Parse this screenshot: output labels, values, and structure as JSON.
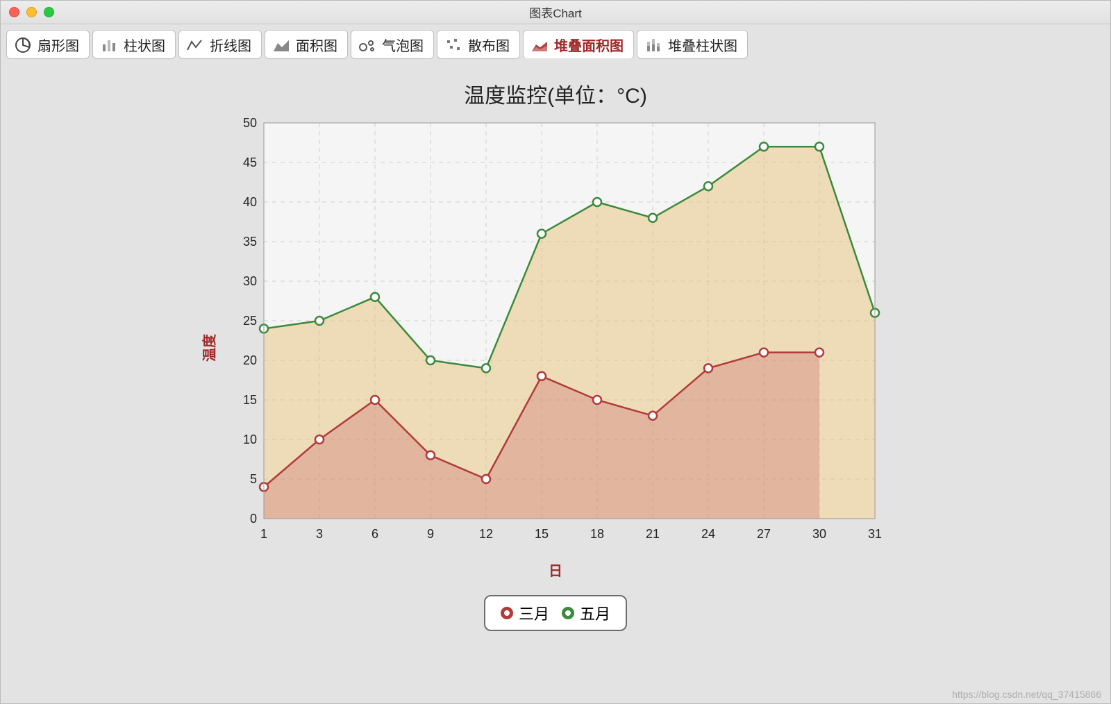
{
  "window": {
    "title": "图表Chart"
  },
  "tabs": [
    {
      "label": "扇形图",
      "icon": "pie-icon"
    },
    {
      "label": "柱状图",
      "icon": "bar-icon"
    },
    {
      "label": "折线图",
      "icon": "line-icon"
    },
    {
      "label": "面积图",
      "icon": "area-icon"
    },
    {
      "label": "气泡图",
      "icon": "bubble-icon"
    },
    {
      "label": "散布图",
      "icon": "scatter-icon"
    },
    {
      "label": "堆叠面积图",
      "icon": "stacked-area-icon"
    },
    {
      "label": "堆叠柱状图",
      "icon": "stacked-bar-icon"
    }
  ],
  "colors": {
    "series1": "#b23a3a",
    "series1_fill": "rgba(200,110,110,0.35)",
    "series2": "#3b8a3b",
    "series2_fill": "rgba(230,190,110,0.45)",
    "accent": "#a02828",
    "grid": "#cfcfcf",
    "plot_bg": "#f5f5f5"
  },
  "legend": [
    {
      "label": "三月",
      "color": "#b23a3a"
    },
    {
      "label": "五月",
      "color": "#3b8a3b"
    }
  ],
  "watermark": "https://blog.csdn.net/qq_37415866",
  "chart_data": {
    "type": "area",
    "stacked": true,
    "title": "温度监控(单位：°C)",
    "xlabel": "日",
    "ylabel": "温度",
    "ylim": [
      0,
      50
    ],
    "yticks": [
      0,
      5,
      10,
      15,
      20,
      25,
      30,
      35,
      40,
      45,
      50
    ],
    "categories": [
      1,
      3,
      6,
      9,
      12,
      15,
      18,
      21,
      24,
      27,
      30,
      31
    ],
    "series": [
      {
        "name": "三月",
        "color": "#b23a3a",
        "values": [
          4,
          10,
          15,
          8,
          5,
          18,
          15,
          13,
          19,
          21,
          21,
          null
        ]
      },
      {
        "name": "五月",
        "color": "#3b8a3b",
        "values": [
          24,
          25,
          28,
          20,
          19,
          36,
          40,
          38,
          42,
          47,
          47,
          26
        ]
      }
    ]
  }
}
